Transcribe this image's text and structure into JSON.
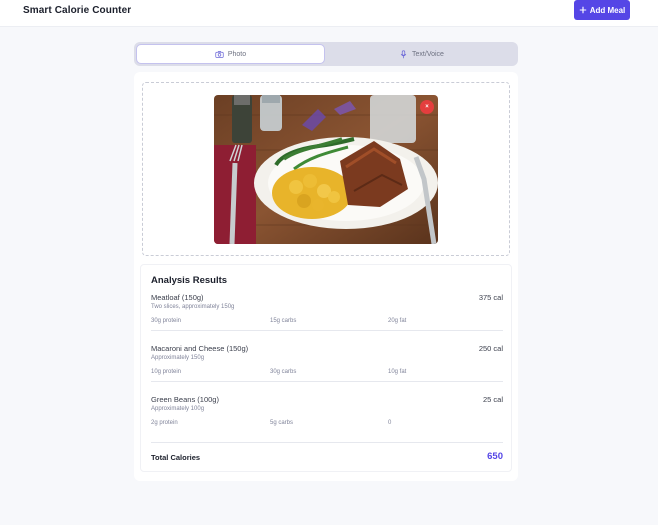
{
  "header": {
    "title": "Smart Calorie Counter",
    "add_meal_label": "Add Meal"
  },
  "tabs": [
    {
      "label": "Photo",
      "icon": "camera-icon",
      "active": true
    },
    {
      "label": "Text/Voice",
      "icon": "microphone-icon",
      "active": false
    }
  ],
  "upload": {
    "remove_label": "×",
    "image": "photo of plate with meatloaf, macaroni and cheese, and green beans"
  },
  "analysis": {
    "title": "Analysis Results",
    "items": [
      {
        "name": "Meatloaf (150g)",
        "calories": "375 cal",
        "description": "Two slices, approximately 150g",
        "protein": "30g protein",
        "carbs": "15g carbs",
        "fat": "20g fat"
      },
      {
        "name": "Macaroni and Cheese (150g)",
        "calories": "250 cal",
        "description": "Approximately 150g",
        "protein": "10g protein",
        "carbs": "30g carbs",
        "fat": "10g fat"
      },
      {
        "name": "Green Beans (100g)",
        "calories": "25 cal",
        "description": "Approximately 100g",
        "protein": "2g protein",
        "carbs": "5g carbs",
        "fat": "0"
      }
    ],
    "total_label": "Total Calories",
    "total_value": "650"
  },
  "colors": {
    "accent": "#5546e6",
    "remove": "#e43e3e"
  }
}
